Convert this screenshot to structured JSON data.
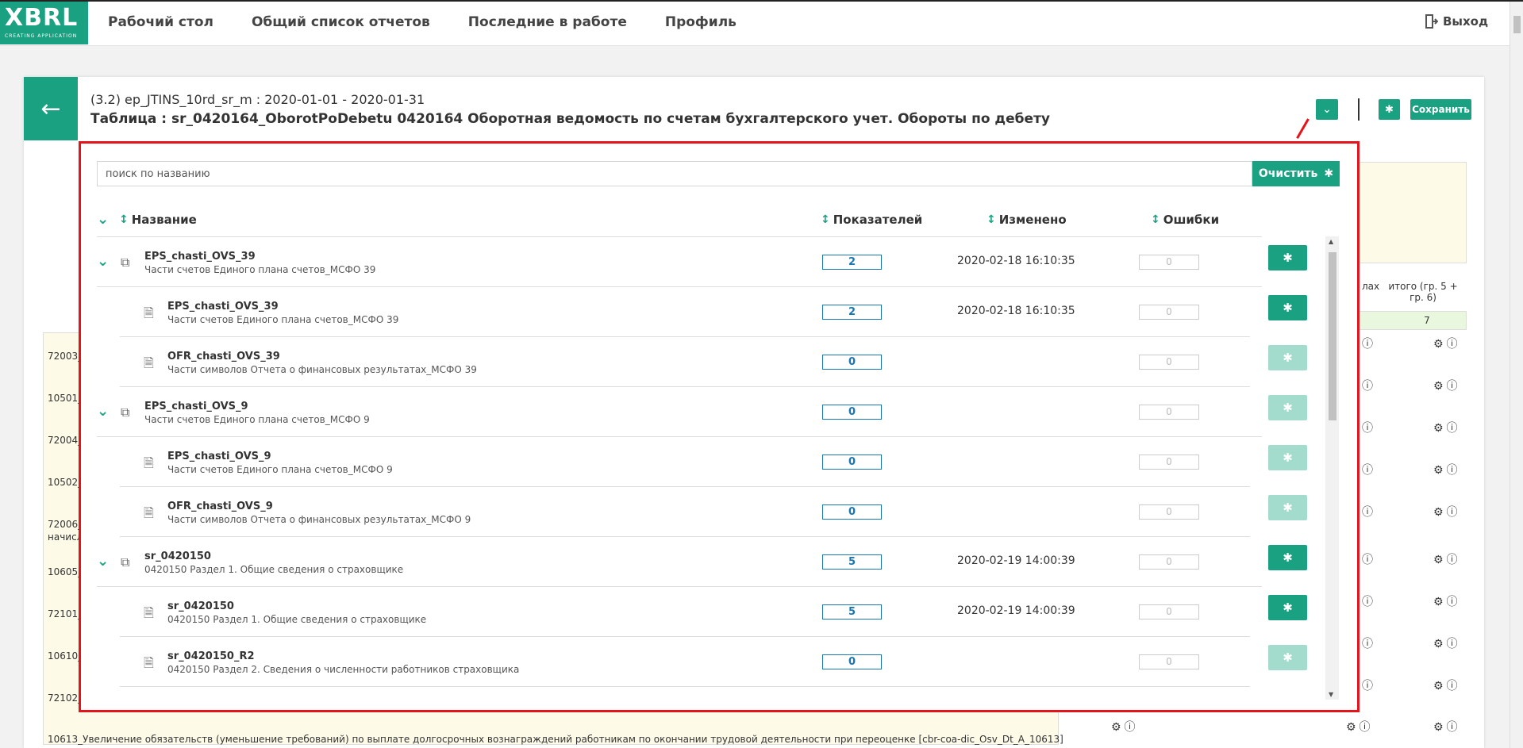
{
  "nav": {
    "logo_big": "XBRL",
    "logo_small": "CREATING APPLICATION",
    "items": [
      "Рабочий стол",
      "Общий список отчетов",
      "Последние в работе",
      "Профиль"
    ],
    "logout": "Выход"
  },
  "header": {
    "title": "(3.2) ep_JTINS_10rd_sr_m : 2020-01-01 - 2020-01-31",
    "subtitle": "Таблица : sr_0420164_OborotPoDebetu 0420164 Оборотная ведомость по счетам бухгалтерского учет. Обороты по дебету",
    "save_label": "Сохранить"
  },
  "background": {
    "col_labels": [
      "лах",
      "итого (гр. 5 + гр. 6)"
    ],
    "col_number": "7",
    "row_codes": [
      "72003_",
      "10501_",
      "72004_",
      "10502_",
      "72006_",
      "начисл",
      "10605_",
      "72101_",
      "10610_",
      "72102_"
    ],
    "bottom_text": "10613_Увеличение обязательств (уменьшение требований) по выплате долгосрочных вознаграждений работникам по окончании трудовой деятельности при переоценке [cbr-coa-dic_Osv_Dt_A_10613]"
  },
  "panel": {
    "search_placeholder": "поиск по названию",
    "clear_label": "Очистить",
    "columns": {
      "name": "Название",
      "indicators": "Показателей",
      "changed": "Изменено",
      "errors": "Ошибки"
    },
    "rows": [
      {
        "level": 0,
        "name": "EPS_chasti_OVS_39",
        "desc": "Части счетов Единого плана счетов_МСФО 39",
        "count": "2",
        "changed": "2020-02-18 16:10:35",
        "errors": "0",
        "active": true
      },
      {
        "level": 1,
        "name": "EPS_chasti_OVS_39",
        "desc": "Части счетов Единого плана счетов_МСФО 39",
        "count": "2",
        "changed": "2020-02-18 16:10:35",
        "errors": "0",
        "active": true
      },
      {
        "level": 1,
        "name": "OFR_chasti_OVS_39",
        "desc": "Части символов Отчета о финансовых результатах_МСФО 39",
        "count": "0",
        "changed": "",
        "errors": "0",
        "active": false
      },
      {
        "level": 0,
        "name": "EPS_chasti_OVS_9",
        "desc": "Части счетов Единого плана счетов_МСФО 9",
        "count": "0",
        "changed": "",
        "errors": "0",
        "active": false
      },
      {
        "level": 1,
        "name": "EPS_chasti_OVS_9",
        "desc": "Части счетов Единого плана счетов_МСФО 9",
        "count": "0",
        "changed": "",
        "errors": "0",
        "active": false
      },
      {
        "level": 1,
        "name": "OFR_chasti_OVS_9",
        "desc": "Части символов Отчета о финансовых результатах_МСФО 9",
        "count": "0",
        "changed": "",
        "errors": "0",
        "active": false
      },
      {
        "level": 0,
        "name": "sr_0420150",
        "desc": "0420150 Раздел 1. Общие сведения о страховщике",
        "count": "5",
        "changed": "2020-02-19 14:00:39",
        "errors": "0",
        "active": true
      },
      {
        "level": 1,
        "name": "sr_0420150",
        "desc": "0420150 Раздел 1. Общие сведения о страховщике",
        "count": "5",
        "changed": "2020-02-19 14:00:39",
        "errors": "0",
        "active": true
      },
      {
        "level": 1,
        "name": "sr_0420150_R2",
        "desc": "0420150 Раздел 2. Сведения о численности работников страховщика",
        "count": "0",
        "changed": "",
        "errors": "0",
        "active": false
      }
    ]
  }
}
